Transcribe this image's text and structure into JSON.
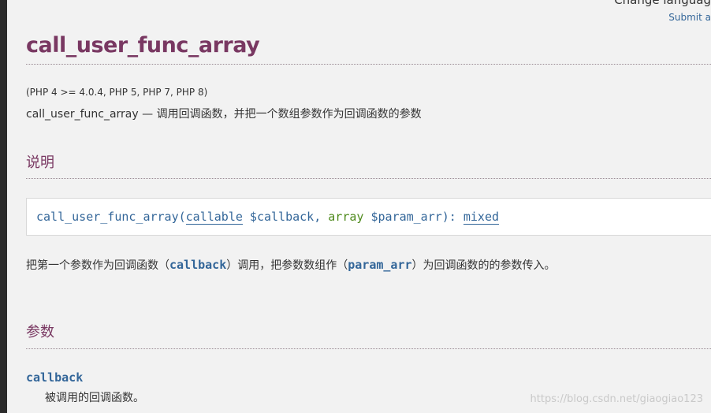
{
  "header": {
    "change_language": "Change languag",
    "submit": "Submit a"
  },
  "title": "call_user_func_array",
  "version": "(PHP 4 >= 4.0.4, PHP 5, PHP 7, PHP 8)",
  "refpurpose": "call_user_func_array — 调用回调函数，并把一个数组参数作为回调函数的参数",
  "description": {
    "heading": "说明",
    "signature": {
      "name": "call_user_func_array",
      "open": "(",
      "type1": "callable",
      "param1": " $callback",
      "sep": ", ",
      "type2": "array",
      "param2": " $param_arr",
      "close": "): ",
      "return_type": "mixed"
    },
    "text_parts": [
      "把第一个参数作为回调函数（",
      "callback",
      "）调用，把参数数组作（",
      "param_arr",
      "）为回调函数的的参数传入。"
    ]
  },
  "parameters": {
    "heading": "参数",
    "items": [
      {
        "name": "callback",
        "desc": "被调用的回调函数。"
      }
    ]
  },
  "watermark": "https://blog.csdn.net/giaogiao123"
}
